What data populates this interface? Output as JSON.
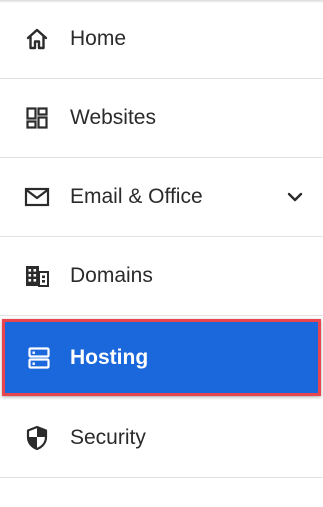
{
  "nav": {
    "items": [
      {
        "label": "Home",
        "icon": "home-icon"
      },
      {
        "label": "Websites",
        "icon": "dashboard-grid-icon"
      },
      {
        "label": "Email & Office",
        "icon": "envelope-icon",
        "expandable": true
      },
      {
        "label": "Domains",
        "icon": "building-icon"
      },
      {
        "label": "Hosting",
        "icon": "server-icon",
        "active": true
      },
      {
        "label": "Security",
        "icon": "shield-icon"
      }
    ]
  },
  "colors": {
    "active_background": "#1a68dc",
    "active_outline": "#e8454f",
    "text": "#2b2b2b",
    "divider": "#e2e2e2"
  }
}
